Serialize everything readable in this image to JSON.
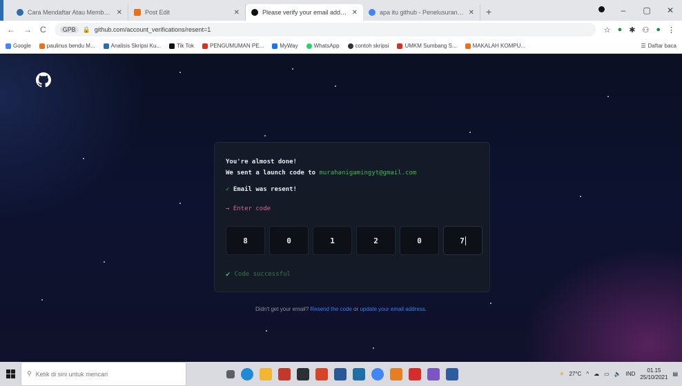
{
  "browser": {
    "tabs": [
      {
        "title": "Cara Mendaftar Atau Membuat Akun",
        "favicon_color": "#2b6cb0",
        "active": false
      },
      {
        "title": "Post Edit",
        "favicon_color": "#e8711a",
        "active": false
      },
      {
        "title": "Please verify your email address",
        "favicon_color": "#111111",
        "active": true
      },
      {
        "title": "apa itu github - Penelusuran Google",
        "favicon_color": "#4285f4",
        "active": false
      }
    ],
    "url": "github.com/account_verifications/resent=1",
    "url_badge": "GPB",
    "bookmarks": [
      {
        "label": "Google",
        "color": "#4285f4"
      },
      {
        "label": "paulinus bendu M...",
        "color": "#e8711a"
      },
      {
        "label": "Analisis Skripsi Ku...",
        "color": "#2b6cb0"
      },
      {
        "label": "Tik Tok",
        "color": "#111111"
      },
      {
        "label": "PENGUMUMAN PE...",
        "color": "#d93025"
      },
      {
        "label": "MyWay",
        "color": "#1a73e8"
      },
      {
        "label": "WhatsApp",
        "color": "#25d366"
      },
      {
        "label": "contoh skripsi",
        "color": "#333333"
      },
      {
        "label": "UMKM Sumbang S...",
        "color": "#d93025"
      },
      {
        "label": "MAKALAH KOMPU...",
        "color": "#e8711a"
      }
    ],
    "bookmarks_more": "Daftar baca"
  },
  "page": {
    "line1": "You're almost done!",
    "line2_prefix": "We sent a launch code to ",
    "email": "murahanigamingyt@gmail.com",
    "resent": "Email was resent!",
    "enter_code_label": "Enter code",
    "code_digits": [
      "8",
      "0",
      "1",
      "2",
      "0",
      "7"
    ],
    "success": "Code successful",
    "footer_prefix": "Didn't get your email? ",
    "footer_resend": "Resend the code",
    "footer_or": " or ",
    "footer_update": "update your email address",
    "footer_end": "."
  },
  "taskbar": {
    "search_placeholder": "Ketik di sini untuk mencari",
    "weather": "27°C",
    "lang": "IND",
    "time": "01.15",
    "date": "25/10/2021"
  }
}
